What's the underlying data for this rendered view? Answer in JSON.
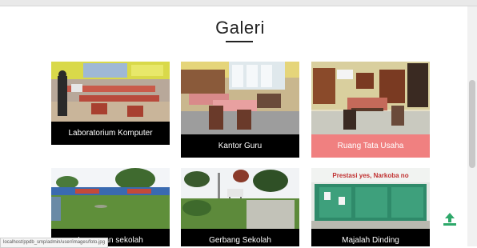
{
  "page": {
    "title": "Galeri",
    "status_url": "localhost/ppdb_smp/admin/user/images/foto.jpg",
    "accent_color": "#f08080"
  },
  "gallery": [
    {
      "caption": "Laboratorium Komputer",
      "active": false
    },
    {
      "caption": "Kantor Guru",
      "active": false
    },
    {
      "caption": "Ruang Tata Usaha",
      "active": true
    },
    {
      "caption": "Lapangan sekolah",
      "active": false
    },
    {
      "caption": "Gerbang Sekolah",
      "active": false
    },
    {
      "caption": "Majalah Dinding",
      "active": false
    }
  ],
  "photo_6_sign": "Prestasi yes, Narkoba no",
  "icons": {
    "upload": "upload-icon"
  }
}
